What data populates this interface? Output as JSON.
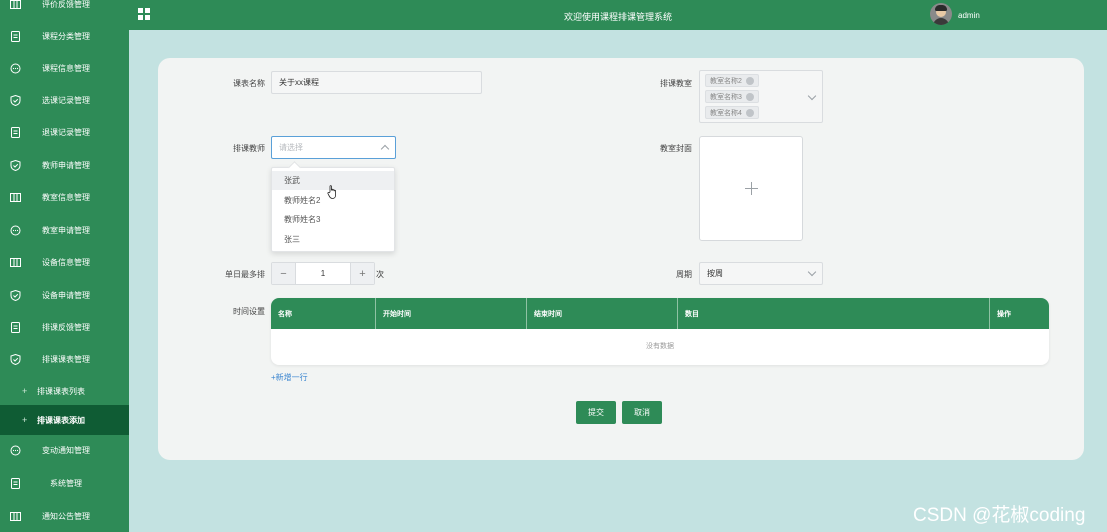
{
  "header": {
    "title": "欢迎使用课程排课管理系统",
    "username": "admin"
  },
  "sidebar": {
    "items": [
      {
        "label": "评价反馈管理",
        "icon": "grid-icon"
      },
      {
        "label": "课程分类管理",
        "icon": "document-icon"
      },
      {
        "label": "课程信息管理",
        "icon": "chat-icon"
      },
      {
        "label": "选课记录管理",
        "icon": "shield-check-icon"
      },
      {
        "label": "退课记录管理",
        "icon": "document-icon"
      },
      {
        "label": "教师申请管理",
        "icon": "shield-check-icon"
      },
      {
        "label": "教室信息管理",
        "icon": "grid-icon"
      },
      {
        "label": "教室申请管理",
        "icon": "chat-icon"
      },
      {
        "label": "设备信息管理",
        "icon": "grid-icon"
      },
      {
        "label": "设备申请管理",
        "icon": "shield-check-icon"
      },
      {
        "label": "排课反馈管理",
        "icon": "document-icon"
      },
      {
        "label": "排课课表管理",
        "icon": "shield-check-icon"
      },
      {
        "label": "排课课表列表",
        "sub": true
      },
      {
        "label": "排课课表添加",
        "sub": true,
        "active": true
      },
      {
        "label": "变动通知管理",
        "icon": "chat-icon"
      },
      {
        "label": "系统管理",
        "icon": "document-icon"
      },
      {
        "label": "通知公告管理",
        "icon": "grid-icon"
      }
    ]
  },
  "form": {
    "course_name_label": "课表名称",
    "course_name_value": "关于xx课程",
    "teacher_label": "排课教师",
    "teacher_placeholder": "请选择",
    "teacher_options": [
      "张武",
      "教师姓名2",
      "教师姓名3",
      "张三"
    ],
    "classroom_label": "排课教室",
    "classroom_tags": [
      "教室名称2",
      "教室名称3",
      "教室名称4"
    ],
    "cover_label": "教室封面",
    "max_per_day_label": "单日最多排",
    "max_per_day_value": "1",
    "max_per_day_unit": "次",
    "period_label": "周期",
    "period_value": "按周",
    "time_label": "时间设置",
    "table_headers": [
      "名称",
      "开始时间",
      "结束时间",
      "数目",
      "操作"
    ],
    "table_empty": "没有数据",
    "add_row": "+新增一行",
    "submit": "提交",
    "cancel": "取消"
  },
  "watermark": "CSDN @花椒coding",
  "colors": {
    "primary": "#2e8b57",
    "active_sidebar": "#0f5c34",
    "background": "#c3e2e1",
    "link": "#3c86d0"
  }
}
